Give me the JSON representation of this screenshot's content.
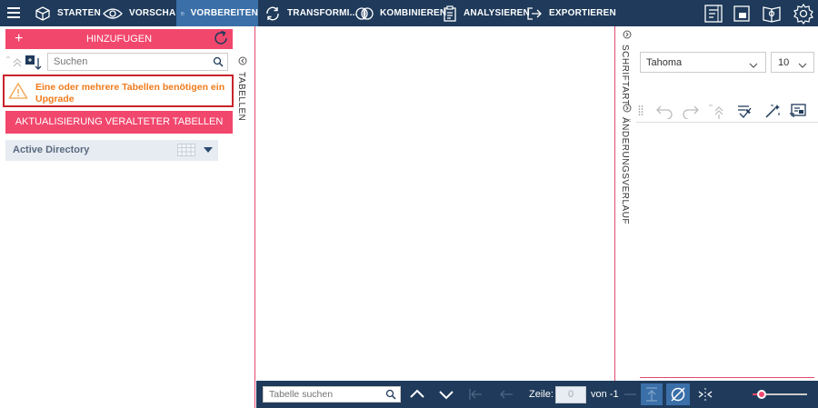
{
  "topnav": {
    "menu_icon": "hamburger-icon",
    "items": [
      {
        "label": "STARTEN",
        "icon": "cube-icon"
      },
      {
        "label": "VORSCHAU",
        "icon": "eye-icon"
      },
      {
        "label": "VORBEREITEN",
        "icon": "table-icon"
      },
      {
        "label": "TRANSFORMI...",
        "icon": "transform-icon"
      },
      {
        "label": "KOMBINIEREN",
        "icon": "combine-icon"
      },
      {
        "label": "ANALYSIEREN",
        "icon": "clipboard-icon"
      },
      {
        "label": "EXPORTIEREN",
        "icon": "export-icon"
      }
    ],
    "active_item": "VORBEREITEN",
    "right_icons": [
      "notes-icon",
      "window-icon",
      "book-icon",
      "settings-icon"
    ]
  },
  "left_panel": {
    "add_button": "HINZUFUGEN",
    "search_placeholder": "Suchen",
    "warning": "Eine oder mehrere Tabellen benötigen ein Upgrade",
    "update_button": "AKTUALISIERUNG VERALTETER TABELLEN",
    "tables": [
      {
        "name": "Active Directory"
      }
    ],
    "vertical_tab": "TABELLEN"
  },
  "right_strip": {
    "tab1": "SCHRIFTART",
    "tab2": "ÄNDERUNGSVERLAUF"
  },
  "right_panel": {
    "font_family": "Tahoma",
    "font_size": "10"
  },
  "bottom_bar": {
    "table_search_placeholder": "Tabelle suchen",
    "zeile_label": "Zeile:",
    "zeile_value": "0",
    "von_label": "von -1",
    "zoom_level": 0.1
  },
  "colors": {
    "nav_bg": "#1f3a5a",
    "accent": "#f2476d",
    "active_tab": "#3a6fa8",
    "warning_text": "#f07a1a",
    "warning_border": "#c8232c"
  }
}
